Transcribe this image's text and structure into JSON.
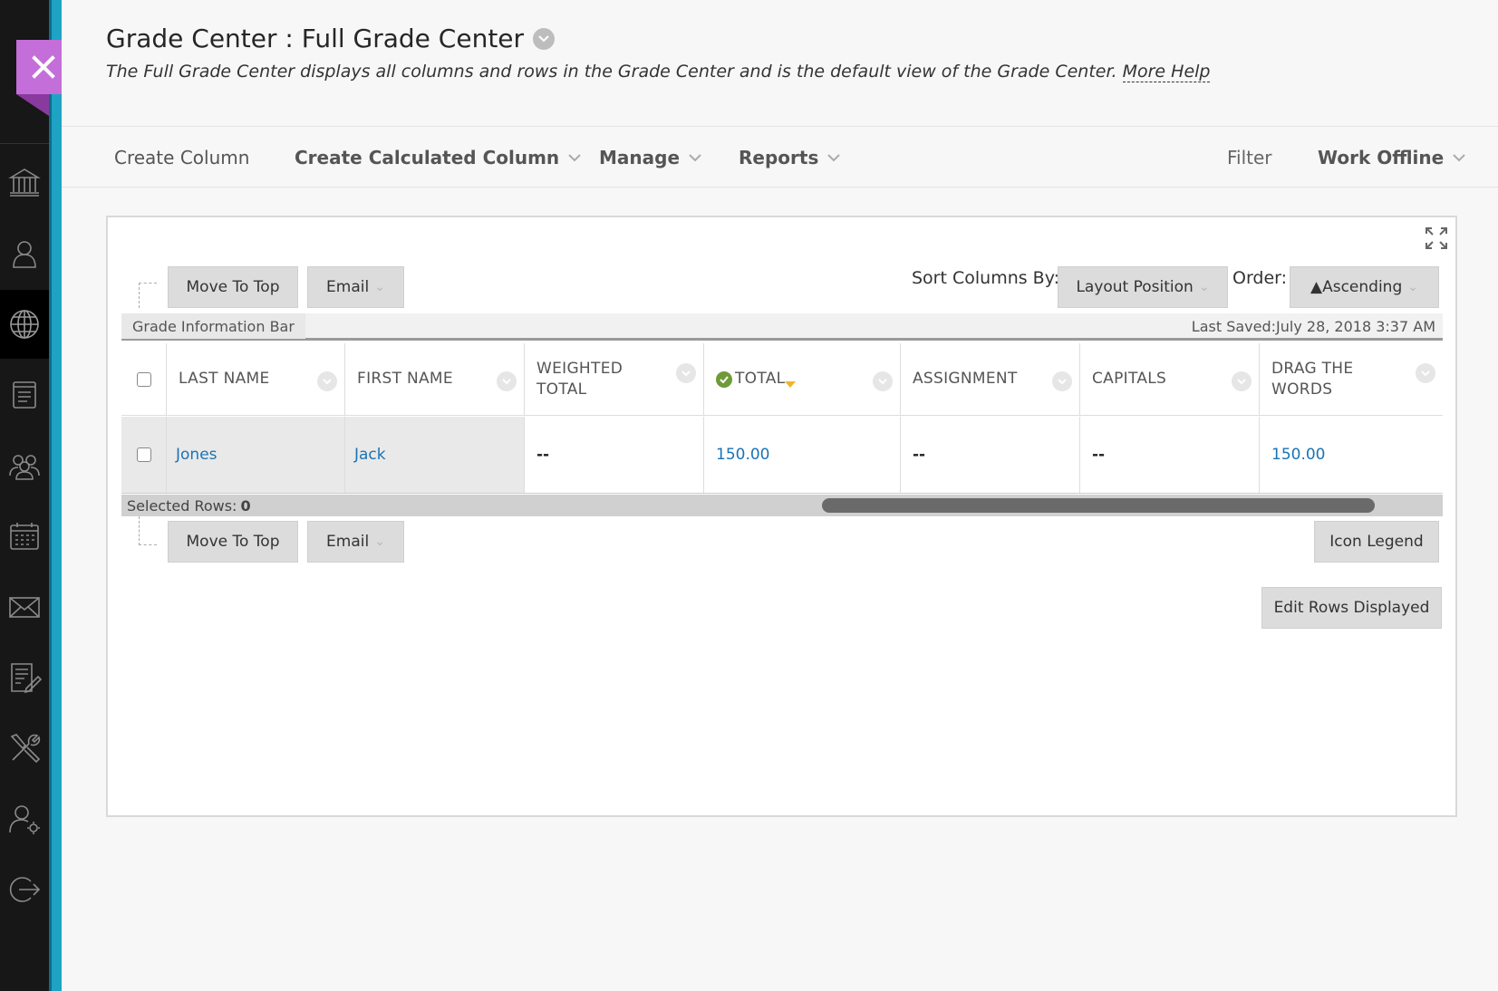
{
  "page": {
    "title": "Grade Center : Full Grade Center",
    "description": "The Full Grade Center displays all columns and rows in the Grade Center and is the default view of the Grade Center.",
    "more_help": "More Help"
  },
  "actionbar": {
    "create_column": "Create Column",
    "create_calculated_column": "Create Calculated Column",
    "manage": "Manage",
    "reports": "Reports",
    "filter": "Filter",
    "work_offline": "Work Offline"
  },
  "toolbar": {
    "move_to_top": "Move To Top",
    "email": "Email",
    "sort_columns_by": "Sort Columns By:",
    "sort_value": "Layout Position",
    "order_label": "Order:",
    "order_value": "▲Ascending"
  },
  "info_bar": {
    "tab": "Grade Information Bar",
    "last_saved": "Last Saved:July 28, 2018 3:37 AM"
  },
  "grid": {
    "columns": [
      "LAST NAME",
      "FIRST NAME",
      "WEIGHTED TOTAL",
      "TOTAL",
      "ASSIGNMENT",
      "CAPITALS",
      "DRAG THE WORDS"
    ],
    "rows": [
      {
        "last_name": "Jones",
        "first_name": "Jack",
        "weighted_total": "--",
        "total": "150.00",
        "assignment": "--",
        "capitals": "--",
        "drag_the_words": "150.00"
      }
    ]
  },
  "footer": {
    "selected_rows_label": "Selected Rows:",
    "selected_rows_count": "0",
    "icon_legend": "Icon Legend",
    "edit_rows_displayed": "Edit Rows Displayed"
  },
  "nav_icons": [
    "close-icon",
    "institution-icon",
    "profile-icon",
    "globe-icon",
    "courses-icon",
    "organizations-icon",
    "calendar-icon",
    "messages-icon",
    "grades-icon",
    "tools-icon",
    "admin-user-icon",
    "sign-out-icon"
  ],
  "colors": {
    "accent_close": "#c46ed9",
    "rail": "#171717",
    "stripe": "#1fa3c4",
    "link": "#1a73b5"
  }
}
